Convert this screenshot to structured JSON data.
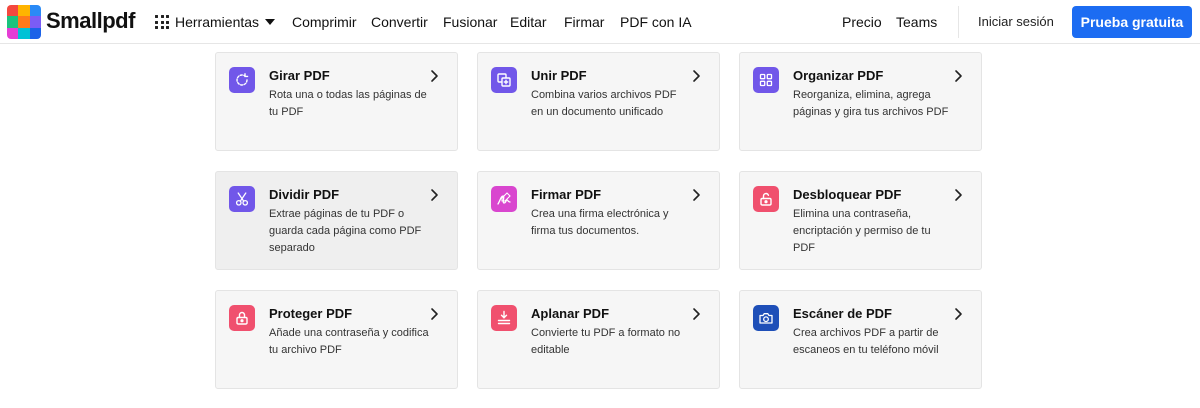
{
  "header": {
    "brand": "Smallpdf",
    "logo_colors": [
      "#f4483f",
      "#ffb400",
      "#2a8af6",
      "#19c37d",
      "#ff7a1a",
      "#7b5cf5",
      "#e53dd5",
      "#00c2d6",
      "#1b62e8"
    ],
    "tools_label": "Herramientas",
    "nav": [
      "Comprimir",
      "Convertir",
      "Fusionar",
      "Editar",
      "Firmar",
      "PDF con IA"
    ],
    "right_nav": [
      "Precio",
      "Teams"
    ],
    "login": "Iniciar sesión",
    "cta": "Prueba gratuita",
    "cta_color": "#1c6cf2"
  },
  "tools": [
    {
      "title": "Girar PDF",
      "desc": "Rota una o todas las páginas de tu PDF",
      "icon": "rotate-icon",
      "color": "#7157e9"
    },
    {
      "title": "Unir PDF",
      "desc": "Combina varios archivos PDF en un documento unificado",
      "icon": "merge-icon",
      "color": "#7157e9"
    },
    {
      "title": "Organizar PDF",
      "desc": "Reorganiza, elimina, agrega páginas y gira tus archivos PDF",
      "icon": "organize-icon",
      "color": "#7157e9"
    },
    {
      "title": "Dividir PDF",
      "desc": "Extrae páginas de tu PDF o guarda cada página como PDF separado",
      "icon": "scissors-icon",
      "color": "#7157e9"
    },
    {
      "title": "Firmar PDF",
      "desc": "Crea una firma electrónica y firma tus documentos.",
      "icon": "signature-icon",
      "color": "#d946cf"
    },
    {
      "title": "Desbloquear PDF",
      "desc": "Elimina una contraseña, encriptación y permiso de tu PDF",
      "icon": "unlock-icon",
      "color": "#f0506e"
    },
    {
      "title": "Proteger PDF",
      "desc": "Añade una contraseña y codifica tu archivo PDF",
      "icon": "lock-icon",
      "color": "#f0506e"
    },
    {
      "title": "Aplanar PDF",
      "desc": "Convierte tu PDF a formato no editable",
      "icon": "flatten-icon",
      "color": "#f0506e"
    },
    {
      "title": "Escáner de PDF",
      "desc": "Crea archivos PDF a partir de escaneos en tu teléfono móvil",
      "icon": "camera-icon",
      "color": "#1e4fb8"
    }
  ]
}
